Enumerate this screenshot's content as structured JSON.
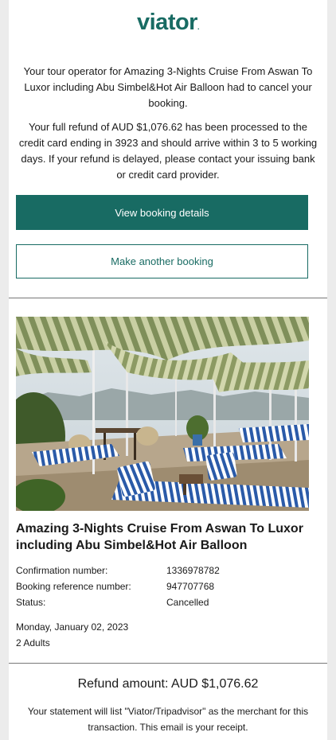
{
  "brand": {
    "logo_text": "viator",
    "logo_dot": ".",
    "color": "#186b63"
  },
  "message": {
    "cancellation": "Your tour operator for Amazing 3-Nights Cruise From Aswan To Luxor including Abu Simbel&Hot Air Balloon had to cancel your booking.",
    "refund_info": "Your full refund of AUD $1,076.62 has been processed to the credit card ending in 3923 and should arrive within 3 to 5 working days. If your refund is delayed, please contact your issuing bank or credit card provider."
  },
  "actions": {
    "view_booking": "View booking details",
    "make_another": "Make another booking"
  },
  "tour": {
    "image": "cruise-deck-photo",
    "title": "Amazing 3-Nights Cruise From Aswan To Luxor including Abu Simbel&Hot Air Balloon"
  },
  "details": {
    "confirmation_label": "Confirmation number:",
    "confirmation_value": "1336978782",
    "reference_label": "Booking reference number:",
    "reference_value": "947707768",
    "status_label": "Status:",
    "status_value": "Cancelled",
    "date": "Monday, January 02, 2023",
    "travellers": "2 Adults"
  },
  "refund": {
    "amount_text": "Refund amount: AUD $1,076.62",
    "statement": "Your statement will list \"Viator/Tripadvisor\" as the merchant for this transaction. This email is your receipt."
  }
}
